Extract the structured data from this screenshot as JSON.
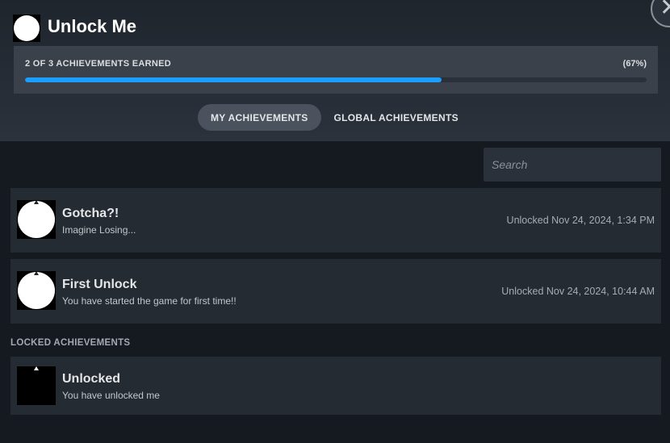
{
  "header": {
    "title": "Unlock Me",
    "close_icon": "close-icon"
  },
  "progress": {
    "label": "2 OF 3 ACHIEVEMENTS EARNED",
    "percent_label": "(67%)",
    "fraction": 0.67,
    "fill_color": "#1a9fff"
  },
  "tabs": [
    {
      "label": "MY ACHIEVEMENTS",
      "active": true
    },
    {
      "label": "GLOBAL ACHIEVEMENTS",
      "active": false
    }
  ],
  "search": {
    "placeholder": "Search",
    "value": ""
  },
  "unlocked": [
    {
      "name": "Gotcha?!",
      "description": "Imagine Losing...",
      "date": "Unlocked Nov 24, 2024, 1:34 PM"
    },
    {
      "name": "First Unlock",
      "description": "You have started the game for first time!!",
      "date": "Unlocked Nov 24, 2024, 10:44 AM"
    }
  ],
  "locked_section": {
    "heading": "LOCKED ACHIEVEMENTS",
    "items": [
      {
        "name": "Unlocked",
        "description": "You have unlocked me"
      }
    ]
  }
}
